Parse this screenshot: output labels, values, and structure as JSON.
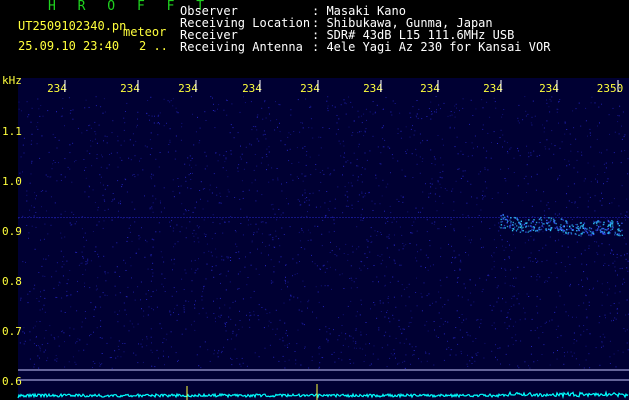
{
  "header": {
    "app_name": "H R O F F T",
    "filename": "UT2509102340.pn",
    "mode": "meteor",
    "datetime": "25.09.10 23:40",
    "count": "2 ..",
    "info": [
      {
        "label": "Observer",
        "value": ": Masaki Kano"
      },
      {
        "label": "Receiving Location",
        "value": ": Shibukawa, Gunma, Japan"
      },
      {
        "label": "Receiver",
        "value": ": SDR# 43dB L15 111.6MHz USB"
      },
      {
        "label": "Receiving Antenna",
        "value": ": 4ele Yagi Az 230 for Kansai VOR"
      }
    ]
  },
  "spectrogram": {
    "freq_unit": "kHz",
    "time_ticks": [
      "234",
      "234",
      "234",
      "234",
      "234",
      "234",
      "234",
      "234",
      "234",
      "2350"
    ],
    "freq_ticks": [
      "1.1",
      "1.0",
      "0.9",
      "0.8",
      "0.7",
      "0.6"
    ],
    "colors": {
      "background": "#000033",
      "noise": "#2828d0",
      "echo": "#30c8ff",
      "trace": "#00ffff",
      "text_tick": "#ffff3c"
    }
  }
}
